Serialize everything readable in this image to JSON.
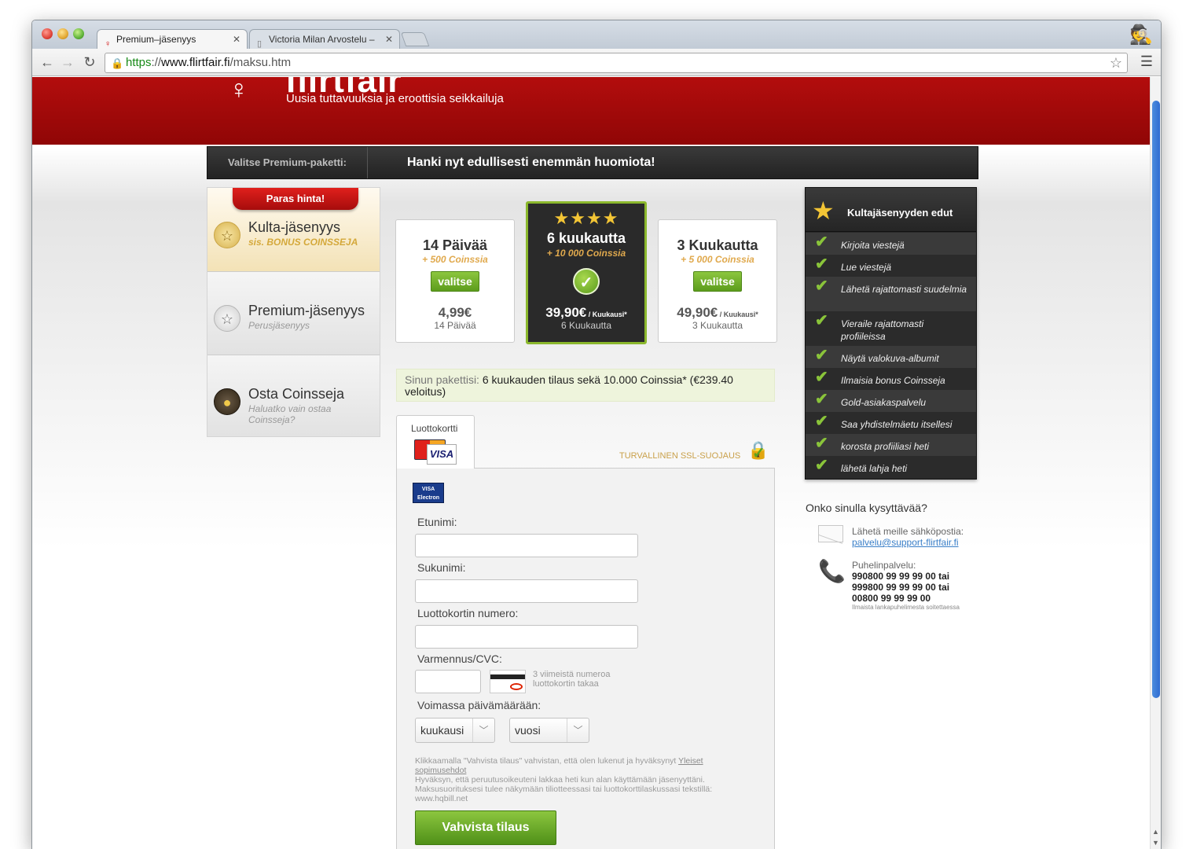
{
  "browser": {
    "tabs": [
      {
        "title": "Premium–jäsenyys",
        "active": true
      },
      {
        "title": "Victoria Milan Arvostelu –",
        "active": false
      }
    ],
    "url": {
      "scheme": "https",
      "sep": "://",
      "host": "www.flirtfair.fi",
      "path": "/maksu.htm"
    }
  },
  "header": {
    "logo": "flirtfair",
    "slogan": "Uusia tuttavuuksia ja eroottisia seikkailuja"
  },
  "premium_bar": {
    "label": "Valitse Premium-paketti:",
    "headline": "Hanki nyt edullisesti enemmän huomiota!"
  },
  "sidebar": {
    "ribbon": "Paras hinta!",
    "items": [
      {
        "title": "Kulta-jäsenyys",
        "subtitle": "sis. BONUS COINSSEJA"
      },
      {
        "title": "Premium-jäsenyys",
        "subtitle": "Perusjäsenyys"
      },
      {
        "title": "Osta Coinsseja",
        "subtitle": "Haluatko vain ostaa Coinsseja?"
      }
    ]
  },
  "plans": [
    {
      "title": "14 Päivää",
      "bonus": "+ 500 Coinssia",
      "button": "valitse",
      "price": "4,99€",
      "per": "",
      "period": "14 Päivää"
    },
    {
      "title": "6 kuukautta",
      "bonus": "+ 10 000 Coinssia",
      "stars": "★★★★",
      "price": "39,90€",
      "per": " / Kuukausi*",
      "period": "6 Kuukautta",
      "selected": true
    },
    {
      "title": "3 Kuukautta",
      "bonus": "+ 5 000 Coinssia",
      "button": "valitse",
      "price": "49,90€",
      "per": " / Kuukausi*",
      "period": "3 Kuukautta"
    }
  ],
  "summary": {
    "label": "Sinun pakettisi:",
    "text": " 6 kuukauden tilaus sekä 10.000 Coinssia* (€239.40 veloitus)"
  },
  "payment": {
    "tab_label": "Luottokortti",
    "visa": "VISA",
    "visa_electron": "VISA Electron",
    "ssl": "TURVALLINEN SSL-SUOJAUS",
    "fields": {
      "first_name": "Etunimi:",
      "last_name": "Sukunimi:",
      "card_number": "Luottokortin numero:",
      "cvc": "Varmennus/CVC:",
      "cvc_hint": "3 viimeistä numeroa luottokortin takaa",
      "expiry": "Voimassa päivämäärään:"
    },
    "month_select": "kuukausi",
    "year_select": "vuosi",
    "terms": {
      "pre": "Klikkaamalla \"Vahvista tilaus\" vahvistan, että olen lukenut ja hyväksynyt ",
      "link": "Yleiset sopimusehdot",
      "line2": "Hyväksyn, että peruutusoikeuteni lakkaa heti kun alan käyttämään jäsenyyttäni.",
      "line3": "Maksusuorituksesi tulee näkymään tiliotteessasi tai luottokorttilaskussasi tekstillä: www.hqbill.net"
    },
    "confirm": "Vahvista tilaus"
  },
  "benefits": {
    "title": "Kultajäsenyyden edut",
    "items": [
      "Kirjoita viestejä",
      "Lue viestejä",
      "Lähetä rajattomasti suudelmia",
      "Vieraile rajattomasti profiileissa",
      "Näytä valokuva-albumit",
      "Ilmaisia bonus Coinsseja",
      "Gold-asiakaspalvelu",
      "Saa yhdistelmäetu itsellesi",
      "korosta profiiliasi heti",
      "lähetä lahja heti"
    ]
  },
  "contact": {
    "title": "Onko sinulla kysyttävää?",
    "email_label": "Lähetä meille sähköpostia:",
    "email": "palvelu@support-flirtfair.fi",
    "phone_label": "Puhelinpalvelu:",
    "phones": [
      "990800 99 99 99 00 tai",
      "999800 99 99 99 00 tai",
      "00800 99 99 99 00"
    ],
    "phone_note": "Ilmaista lankapuhelimesta soitettaessa"
  }
}
